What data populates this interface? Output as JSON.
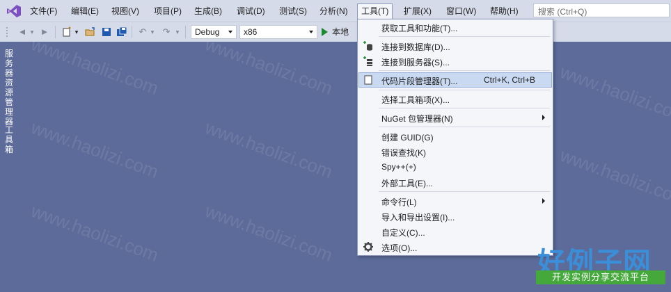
{
  "menubar": {
    "items": [
      "文件(F)",
      "编辑(E)",
      "视图(V)",
      "项目(P)",
      "生成(B)",
      "调试(D)",
      "测试(S)",
      "分析(N)",
      "工具(T)",
      "扩展(X)",
      "窗口(W)",
      "帮助(H)"
    ],
    "search_placeholder": "搜索 (Ctrl+Q)"
  },
  "toolbar": {
    "config": "Debug",
    "platform": "x86",
    "run_label": "本地"
  },
  "sidepanel": {
    "tabs": [
      "服务器资源管理器",
      "工具箱"
    ]
  },
  "tools_menu": {
    "items": [
      {
        "label": "获取工具和功能(T)...",
        "shortcut": "",
        "icon": ""
      },
      {
        "label": "连接到数据库(D)...",
        "shortcut": "",
        "icon": "database-connect-icon"
      },
      {
        "label": "连接到服务器(S)...",
        "shortcut": "",
        "icon": "server-connect-icon"
      },
      {
        "label": "代码片段管理器(T)...",
        "shortcut": "Ctrl+K, Ctrl+B",
        "icon": "snippet-icon"
      },
      {
        "label": "选择工具箱项(X)...",
        "shortcut": "",
        "icon": ""
      },
      {
        "label": "NuGet 包管理器(N)",
        "shortcut": "",
        "icon": "",
        "submenu": true
      },
      {
        "label": "创建 GUID(G)",
        "shortcut": "",
        "icon": ""
      },
      {
        "label": "错误查找(K)",
        "shortcut": "",
        "icon": ""
      },
      {
        "label": "Spy++(+)",
        "shortcut": "",
        "icon": ""
      },
      {
        "label": "外部工具(E)...",
        "shortcut": "",
        "icon": ""
      },
      {
        "label": "命令行(L)",
        "shortcut": "",
        "icon": "",
        "submenu": true
      },
      {
        "label": "导入和导出设置(I)...",
        "shortcut": "",
        "icon": ""
      },
      {
        "label": "自定义(C)...",
        "shortcut": "",
        "icon": ""
      },
      {
        "label": "选项(O)...",
        "shortcut": "",
        "icon": "gear-icon"
      }
    ]
  },
  "watermark": {
    "text": "www.haolizi.com",
    "brand_big": "好例子网",
    "brand_small": "开发实例分享交流平台"
  }
}
